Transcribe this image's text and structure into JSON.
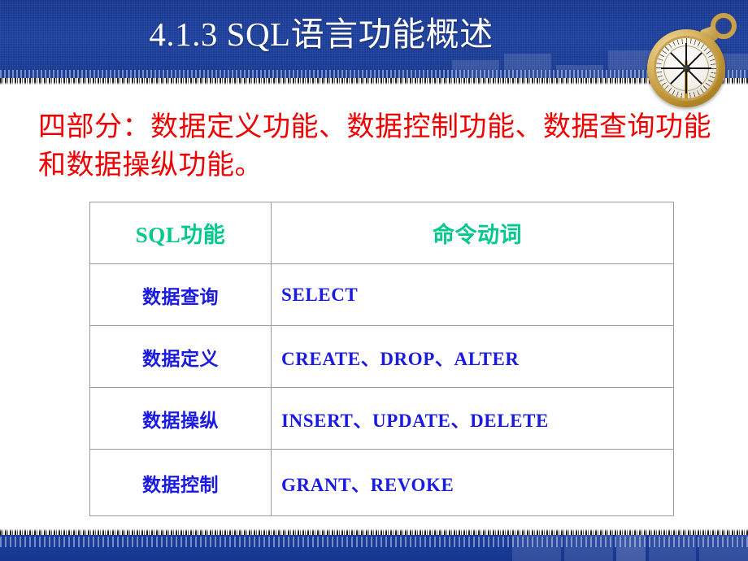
{
  "slide": {
    "title": "4.1.3 SQL语言功能概述",
    "decorative_icon": "compass-icon",
    "body_paragraph": "四部分：数据定义功能、数据控制功能、数据查询功能和数据操纵功能。"
  },
  "colors": {
    "header_blue": "#16358e",
    "title_text": "#ffffff",
    "paragraph_red": "#ef0000",
    "table_header_green": "#00c98a",
    "table_text_blue": "#1a1ae0",
    "table_border_gray": "#9c9c9c",
    "slide_background": "#ffffff"
  },
  "table": {
    "headers": [
      "SQL功能",
      "命令动词"
    ],
    "rows": [
      {
        "function": "数据查询",
        "verbs": "SELECT"
      },
      {
        "function": "数据定义",
        "verbs": "CREATE、DROP、ALTER"
      },
      {
        "function": "数据操纵",
        "verbs": "INSERT、UPDATE、DELETE"
      },
      {
        "function": "数据控制",
        "verbs": "GRANT、REVOKE"
      }
    ]
  }
}
